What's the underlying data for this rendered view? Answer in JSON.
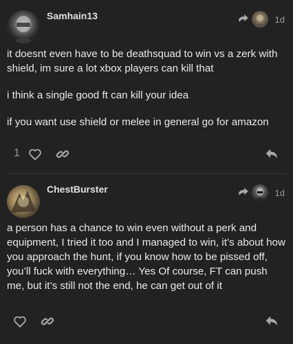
{
  "posts": [
    {
      "username": "Samhain13",
      "age": "1d",
      "paragraphs": [
        "it doesnt even have to be deathsquad to win vs a zerk with shield, im sure a lot xbox players can kill that",
        "i think a single good ft can kill your idea",
        "if you want use shield or melee in general go for amazon"
      ],
      "like_count": "1"
    },
    {
      "username": "ChestBurster",
      "age": "1d",
      "paragraphs": [
        "a person has a chance to win even without a perk and equipment, I tried it too and I managed to win, it’s about how you approach the hunt, if you know how to be pissed off, you’ll fuck with everything… Yes Of course, FT can push me, but it’s still not the end, he can get out of it"
      ],
      "like_count": ""
    }
  ],
  "icons": {
    "reply_to": "reply-arrow-icon",
    "like": "heart-icon",
    "share": "link-icon",
    "reply": "reply-icon"
  },
  "colors": {
    "background": "#222222",
    "text": "#eaeaea",
    "muted": "#9a9a9a"
  }
}
